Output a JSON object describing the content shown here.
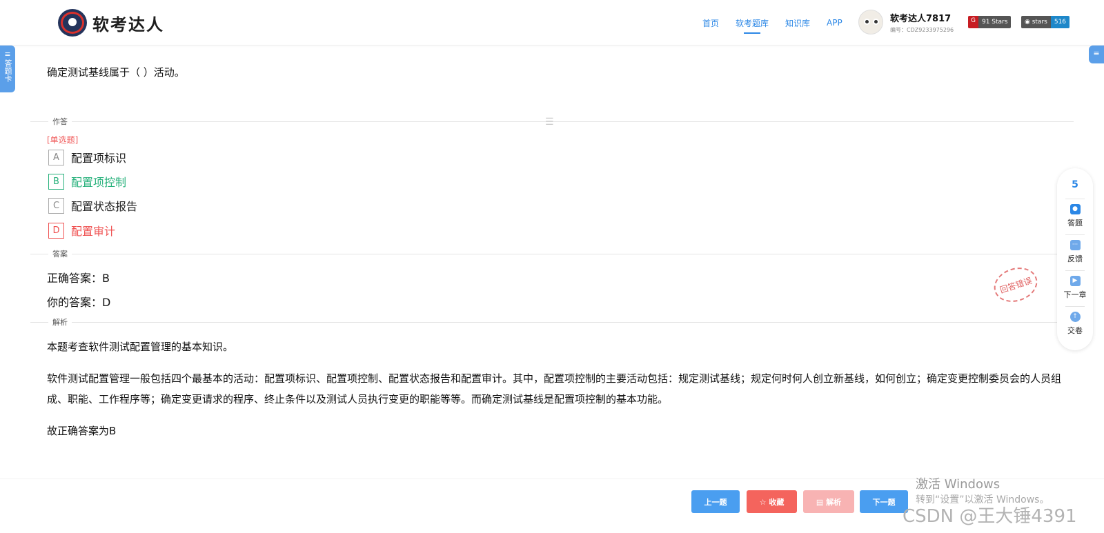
{
  "header": {
    "logo_text": "软考达人",
    "nav": [
      "首页",
      "软考题库",
      "知识库",
      "APP"
    ],
    "user_name": "软考达人7817",
    "user_id": "编号：CDZ9233975296",
    "badge_gitee": "91 Stars",
    "badge_github_left": "stars",
    "badge_github_right": "516"
  },
  "side": {
    "left_tab": "答题卡",
    "left_tab_icon": "≡",
    "right_tab_icon": "≡"
  },
  "question": {
    "text": "确定测试基线属于（ ）活动。",
    "section_answer": "作答",
    "type": "[单选题]",
    "options": [
      {
        "key": "A",
        "text": "配置项标识"
      },
      {
        "key": "B",
        "text": "配置项控制"
      },
      {
        "key": "C",
        "text": "配置状态报告"
      },
      {
        "key": "D",
        "text": "配置审计"
      }
    ],
    "section_key": "答案",
    "correct_answer": "正确答案：B",
    "your_answer": "你的答案：D",
    "stamp": "回答错误",
    "section_analysis": "解析",
    "analysis": [
      "本题考查软件测试配置管理的基本知识。",
      "软件测试配置管理一般包括四个最基本的活动：配置项标识、配置项控制、配置状态报告和配置审计。其中，配置项控制的主要活动包括：规定测试基线；规定何时何人创立新基线，如何创立；确定变更控制委员会的人员组成、职能、工作程序等；确定变更请求的程序、终止条件以及测试人员执行变更的职能等等。而确定测试基线是配置项控制的基本功能。",
      "故正确答案为B"
    ]
  },
  "toolbar": {
    "count": "5",
    "items": [
      "答题",
      "反馈",
      "下一章",
      "交卷"
    ]
  },
  "footer": {
    "prev": "上一题",
    "favorite": "☆ 收藏",
    "analysis": "▤ 解析",
    "next": "下一题"
  },
  "overlay": {
    "activate_title": "激活 Windows",
    "activate_sub": "转到“设置”以激活 Windows。",
    "csdn": "CSDN @王大锤4391"
  },
  "colors": {
    "accent": "#2b87e6",
    "correct": "#25b07a",
    "wrong": "#ef5050"
  }
}
